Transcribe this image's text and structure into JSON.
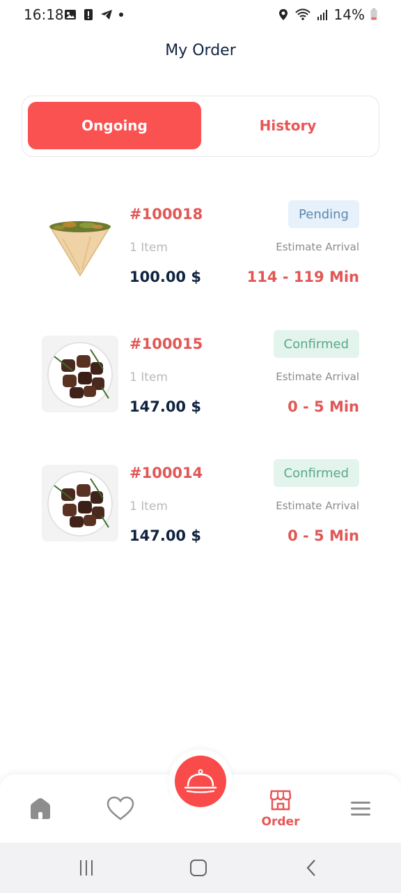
{
  "status_bar": {
    "time": "16:18",
    "battery": "14%",
    "icons": [
      "image-icon",
      "alert-icon",
      "telegram-icon",
      "dot-icon",
      "location-icon",
      "wifi-icon",
      "signal-icon",
      "battery-icon"
    ]
  },
  "header": {
    "title": "My Order"
  },
  "tabs": [
    {
      "label": "Ongoing",
      "active": true
    },
    {
      "label": "History",
      "active": false
    }
  ],
  "orders": [
    {
      "id": "#100018",
      "items": "1 Item",
      "price": "100.00 $",
      "status": "Pending",
      "eta_label": "Estimate Arrival",
      "eta": "114 - 119 Min",
      "image": "wrap-food-image"
    },
    {
      "id": "#100015",
      "items": "1 Item",
      "price": "147.00 $",
      "status": "Confirmed",
      "eta_label": "Estimate Arrival",
      "eta": "0 - 5 Min",
      "image": "grilled-meat-image"
    },
    {
      "id": "#100014",
      "items": "1 Item",
      "price": "147.00 $",
      "status": "Confirmed",
      "eta_label": "Estimate Arrival",
      "eta": "0 - 5 Min",
      "image": "grilled-meat-image"
    }
  ],
  "bottom_nav": {
    "items": [
      {
        "icon": "home-icon",
        "label": ""
      },
      {
        "icon": "heart-icon",
        "label": ""
      },
      {
        "icon": "cloche-icon",
        "label": ""
      },
      {
        "icon": "store-icon",
        "label": "Order",
        "active": true
      },
      {
        "icon": "menu-icon",
        "label": ""
      }
    ]
  },
  "colors": {
    "accent": "#fa5151",
    "navy": "#0f2340",
    "pending_bg": "#e7f1fb",
    "confirmed_bg": "#e3f4ec"
  }
}
